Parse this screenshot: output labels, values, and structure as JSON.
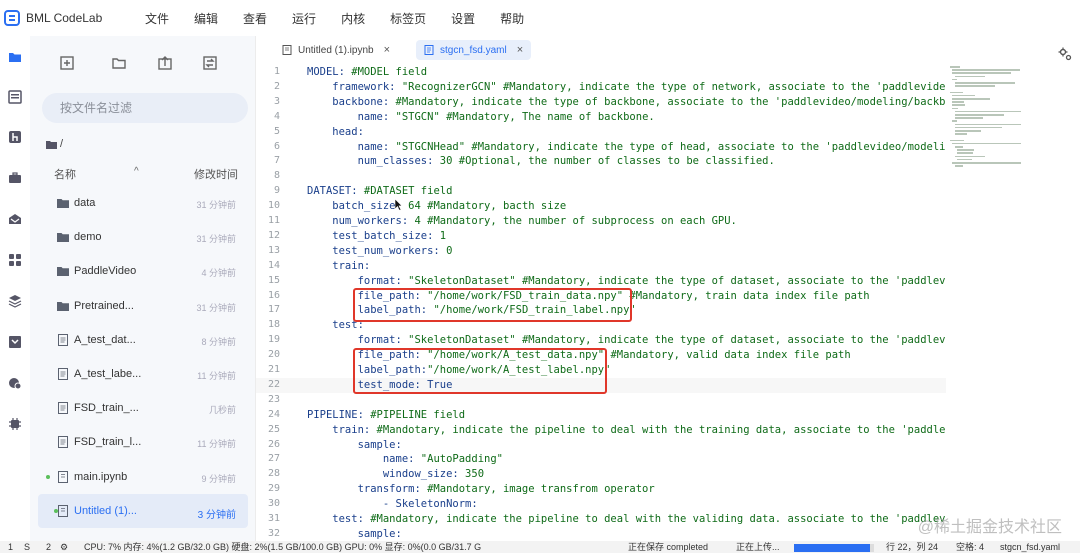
{
  "app": {
    "brand": "BML CodeLab",
    "accent": "#2b6ff2",
    "menu": [
      "文件",
      "编辑",
      "查看",
      "运行",
      "内核",
      "标签页",
      "设置",
      "帮助"
    ]
  },
  "rail_icons": [
    "folder-icon",
    "list-icon",
    "git-icon",
    "briefcase-icon",
    "inbox-icon",
    "apps-icon",
    "layers-icon",
    "download-icon",
    "cloud-icon",
    "chip-icon"
  ],
  "file_panel": {
    "filter_placeholder": "按文件名过滤",
    "path": "/",
    "col_name": "名称",
    "col_time": "修改时间",
    "sort_icon": "^",
    "files": [
      {
        "name": "data",
        "time": "31 分钟前",
        "type": "folder",
        "running": false,
        "selected": false
      },
      {
        "name": "demo",
        "time": "31 分钟前",
        "type": "folder",
        "running": false,
        "selected": false
      },
      {
        "name": "PaddleVideo",
        "time": "4 分钟前",
        "type": "folder",
        "running": false,
        "selected": false
      },
      {
        "name": "Pretrained...",
        "time": "31 分钟前",
        "type": "folder",
        "running": false,
        "selected": false
      },
      {
        "name": "A_test_dat...",
        "time": "8 分钟前",
        "type": "file",
        "running": false,
        "selected": false
      },
      {
        "name": "A_test_labe...",
        "time": "11 分钟前",
        "type": "file",
        "running": false,
        "selected": false
      },
      {
        "name": "FSD_train_...",
        "time": "几秒前",
        "type": "file",
        "running": false,
        "selected": false
      },
      {
        "name": "FSD_train_l...",
        "time": "11 分钟前",
        "type": "file",
        "running": false,
        "selected": false
      },
      {
        "name": "main.ipynb",
        "time": "9 分钟前",
        "type": "notebook",
        "running": true,
        "selected": false
      },
      {
        "name": "Untitled (1)...",
        "time": "3 分钟前",
        "type": "notebook",
        "running": true,
        "selected": true
      }
    ]
  },
  "tabs": [
    {
      "label": "Untitled (1).ipynb",
      "close": "×",
      "active": false
    },
    {
      "label": "stgcn_fsd.yaml",
      "close": "×",
      "active": true
    }
  ],
  "editor": {
    "lines": [
      {
        "n": "1",
        "segs": [
          [
            "k",
            "MODEL: "
          ],
          [
            "c",
            "#MODEL field"
          ]
        ]
      },
      {
        "n": "2",
        "segs": [
          [
            "k",
            "    framework: "
          ],
          [
            "s",
            "\"RecognizerGCN\""
          ],
          [
            "c",
            " #Mandatory, indicate the type of network, associate to the 'paddlevideo/modeling/framework/'"
          ]
        ]
      },
      {
        "n": "3",
        "segs": [
          [
            "k",
            "    backbone: "
          ],
          [
            "c",
            "#Mandatory, indicate the type of backbone, associate to the 'paddlevideo/modeling/backbones/'"
          ]
        ]
      },
      {
        "n": "4",
        "segs": [
          [
            "k",
            "        name: "
          ],
          [
            "s",
            "\"STGCN\""
          ],
          [
            "c",
            " #Mandatory, The name of backbone."
          ]
        ]
      },
      {
        "n": "5",
        "segs": [
          [
            "k",
            "    head:"
          ]
        ]
      },
      {
        "n": "6",
        "segs": [
          [
            "k",
            "        name: "
          ],
          [
            "s",
            "\"STGCNHead\""
          ],
          [
            "c",
            " #Mandatory, indicate the type of head, associate to the 'paddlevideo/modeling/heads'"
          ]
        ]
      },
      {
        "n": "7",
        "segs": [
          [
            "k",
            "        num_classes: "
          ],
          [
            "n",
            "30"
          ],
          [
            "c",
            " #Optional, the number of classes to be classified."
          ]
        ]
      },
      {
        "n": "8",
        "segs": []
      },
      {
        "n": "9",
        "segs": [
          [
            "k",
            "DATASET: "
          ],
          [
            "c",
            "#DATASET field"
          ]
        ]
      },
      {
        "n": "10",
        "segs": [
          [
            "k",
            "    batch_size: "
          ],
          [
            "n",
            "64"
          ],
          [
            "c",
            " #Mandatory, bacth size"
          ]
        ]
      },
      {
        "n": "11",
        "segs": [
          [
            "k",
            "    num_workers: "
          ],
          [
            "n",
            "4"
          ],
          [
            "c",
            " #Mandatory, the number of subprocess on each GPU."
          ]
        ]
      },
      {
        "n": "12",
        "segs": [
          [
            "k",
            "    test_batch_size: "
          ],
          [
            "n",
            "1"
          ]
        ]
      },
      {
        "n": "13",
        "segs": [
          [
            "k",
            "    test_num_workers: "
          ],
          [
            "n",
            "0"
          ]
        ]
      },
      {
        "n": "14",
        "segs": [
          [
            "k",
            "    train:"
          ]
        ]
      },
      {
        "n": "15",
        "segs": [
          [
            "k",
            "        format: "
          ],
          [
            "s",
            "\"SkeletonDataset\""
          ],
          [
            "c",
            " #Mandatory, indicate the type of dataset, associate to the 'paddlevideo/loader/dataset'"
          ]
        ]
      },
      {
        "n": "16",
        "segs": [
          [
            "k",
            "        file_path: "
          ],
          [
            "s",
            "\"/home/work/FSD_train_data.npy\""
          ],
          [
            "c",
            " #Mandatory, train data index file path"
          ]
        ]
      },
      {
        "n": "17",
        "segs": [
          [
            "k",
            "        label_path: "
          ],
          [
            "s",
            "\"/home/work/FSD_train_label.npy\""
          ]
        ]
      },
      {
        "n": "18",
        "segs": [
          [
            "k",
            "    test:"
          ]
        ]
      },
      {
        "n": "19",
        "segs": [
          [
            "k",
            "        format: "
          ],
          [
            "s",
            "\"SkeletonDataset\""
          ],
          [
            "c",
            " #Mandatory, indicate the type of dataset, associate to the 'paddlevideo/loader/dataset'"
          ]
        ]
      },
      {
        "n": "20",
        "segs": [
          [
            "k",
            "        file_path: "
          ],
          [
            "s",
            "\"/home/work/A_test_data.npy\""
          ],
          [
            "c",
            " #Mandatory, valid data index file path"
          ]
        ]
      },
      {
        "n": "21",
        "segs": [
          [
            "k",
            "        label_path:"
          ],
          [
            "s",
            "\"/home/work/A_test_label.npy\""
          ]
        ]
      },
      {
        "n": "22",
        "segs": [
          [
            "k",
            "        test_mode: "
          ],
          [
            "b",
            "True"
          ]
        ]
      },
      {
        "n": "23",
        "segs": []
      },
      {
        "n": "24",
        "segs": [
          [
            "k",
            "PIPELINE: "
          ],
          [
            "c",
            "#PIPELINE field"
          ]
        ]
      },
      {
        "n": "25",
        "segs": [
          [
            "k",
            "    train: "
          ],
          [
            "c",
            "#Mandotary, indicate the pipeline to deal with the training data, associate to the 'paddlevideo/loader/pipelines/'"
          ]
        ]
      },
      {
        "n": "26",
        "segs": [
          [
            "k",
            "        sample:"
          ]
        ]
      },
      {
        "n": "27",
        "segs": [
          [
            "k",
            "            name: "
          ],
          [
            "s",
            "\"AutoPadding\""
          ]
        ]
      },
      {
        "n": "28",
        "segs": [
          [
            "k",
            "            window_size: "
          ],
          [
            "n",
            "350"
          ]
        ]
      },
      {
        "n": "29",
        "segs": [
          [
            "k",
            "        transform: "
          ],
          [
            "c",
            "#Mandotary, image transfrom operator"
          ]
        ]
      },
      {
        "n": "30",
        "segs": [
          [
            "k",
            "            - SkeletonNorm:"
          ]
        ]
      },
      {
        "n": "31",
        "segs": [
          [
            "k",
            "    test: "
          ],
          [
            "c",
            "#Mandatory, indicate the pipeline to deal with the validing data. associate to the 'paddlevideo/loader/pipelines/'"
          ]
        ]
      },
      {
        "n": "32",
        "segs": [
          [
            "k",
            "        sample:"
          ]
        ]
      }
    ]
  },
  "status": {
    "left_a": "1",
    "left_b": "S",
    "left_c": "2",
    "resources": "CPU: 7%  内存: 4%(1.2 GB/32.0 GB)  硬盘: 2%(1.5 GB/100.0 GB)  GPU: 0%  显存: 0%(0.0 GB/31.7 G",
    "saving": "正在保存 completed",
    "uploading": "正在上传...",
    "upload_progress": 0.95,
    "position": "行 22，列 24",
    "indent": "空格: 4",
    "filename": "stgcn_fsd.yaml"
  },
  "watermark": "@稀土掘金技术社区"
}
